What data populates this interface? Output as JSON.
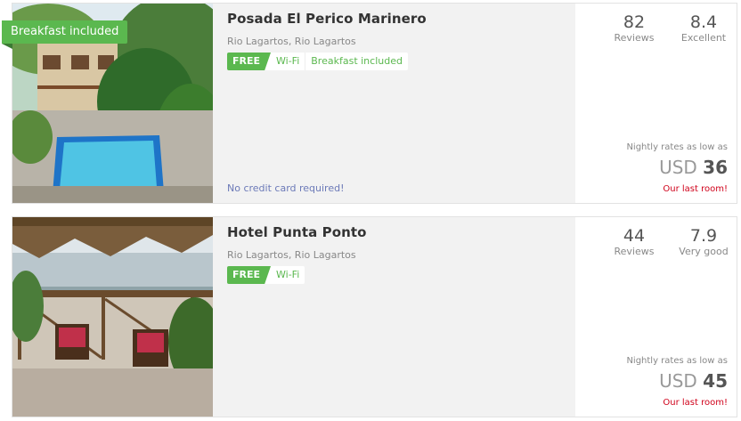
{
  "colors": {
    "accent_green": "#5bb84f",
    "alert_red": "#d0021b",
    "link_blue": "#6c7ab8"
  },
  "hotels": [
    {
      "ribbon": "Breakfast included",
      "name": "Posada El Perico Marinero",
      "location": "Rio Lagartos, Rio Lagartos",
      "free_label": "FREE",
      "amenities": [
        "Wi-Fi",
        "Breakfast included"
      ],
      "note": "No credit card required!",
      "reviews_count": "82",
      "reviews_label": "Reviews",
      "score": "8.4",
      "score_label": "Excellent",
      "nightly_label": "Nightly rates as low as",
      "currency": "USD",
      "price": "36",
      "availability": "Our last room!"
    },
    {
      "name": "Hotel Punta Ponto",
      "location": "Rio Lagartos, Rio Lagartos",
      "free_label": "FREE",
      "amenities": [
        "Wi-Fi"
      ],
      "reviews_count": "44",
      "reviews_label": "Reviews",
      "score": "7.9",
      "score_label": "Very good",
      "nightly_label": "Nightly rates as low as",
      "currency": "USD",
      "price": "45",
      "availability": "Our last room!"
    }
  ]
}
